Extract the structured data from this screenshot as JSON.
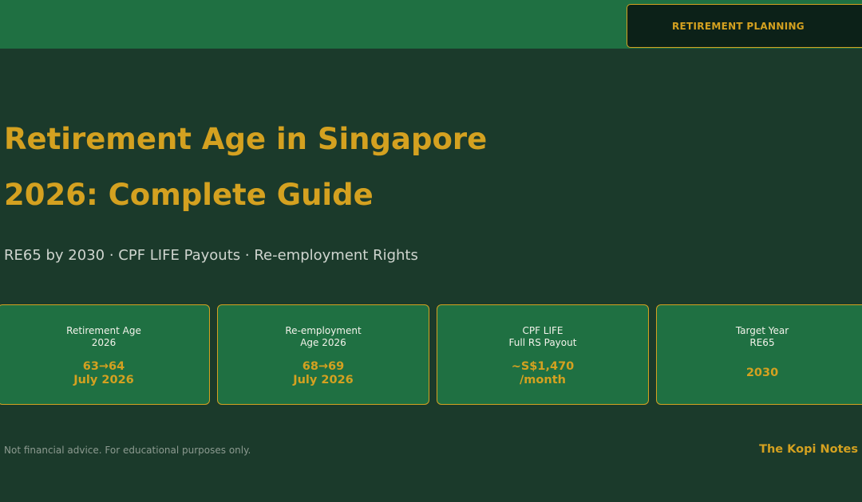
{
  "header": {
    "badge": "RETIREMENT PLANNING"
  },
  "hero": {
    "title_line1": "Retirement Age in Singapore",
    "title_line2": "2026: Complete Guide",
    "subtitle": "RE65 by 2030 · CPF LIFE Payouts · Re-employment Rights"
  },
  "cards": [
    {
      "label": "Retirement Age\n2026",
      "value": "63→64\nJuly 2026"
    },
    {
      "label": "Re-employment\nAge 2026",
      "value": "68→69\nJuly 2026"
    },
    {
      "label": "CPF LIFE\nFull RS Payout",
      "value": "~S$1,470\n/month"
    },
    {
      "label": "Target Year\nRE65",
      "value": "2030"
    }
  ],
  "footer": {
    "disclaimer": "Not financial advice. For educational purposes only.",
    "brand": "The Kopi Notes"
  },
  "colors": {
    "background": "#1b3a2b",
    "bar": "#1f7042",
    "accent": "#d4a120"
  }
}
